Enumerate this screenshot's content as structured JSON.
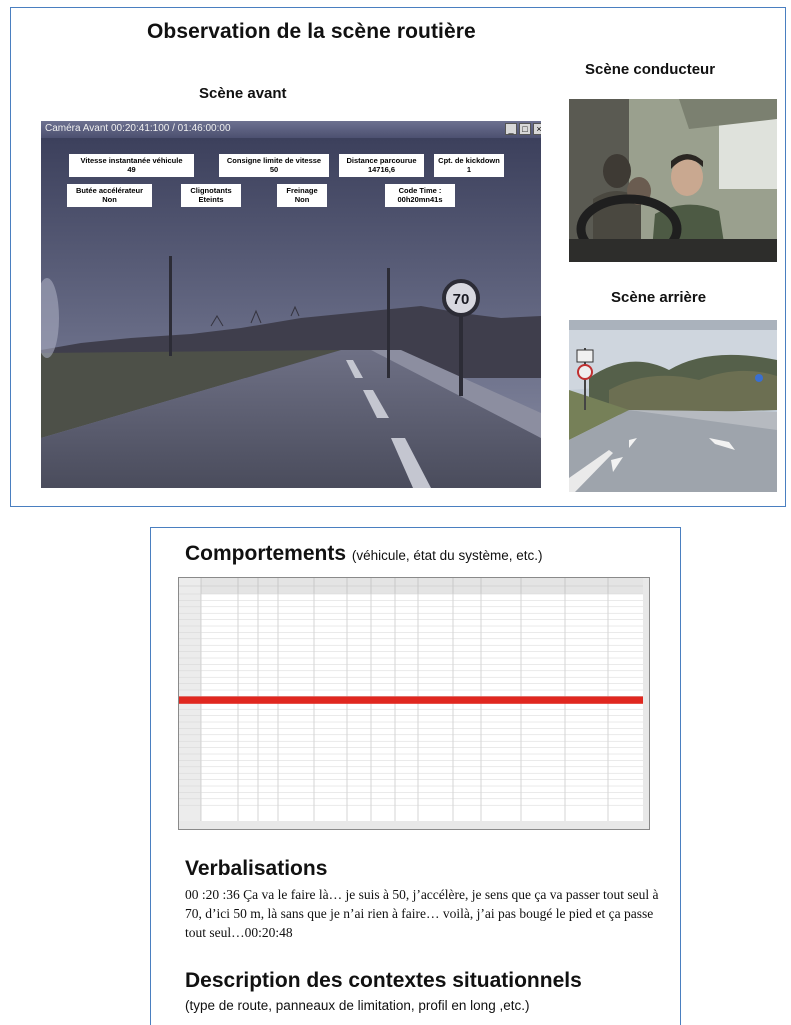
{
  "top_figure": {
    "title": "Observation de la scène routière",
    "front_view": {
      "title": "Scène avant",
      "window_title": "Caméra Avant 00:20:41:100 / 01:46:00:00",
      "window_buttons": [
        "_",
        "□",
        "×"
      ],
      "overlays": [
        {
          "label": "Vitesse instantanée véhicule",
          "value": "49"
        },
        {
          "label": "Consigne limite de vitesse",
          "value": "50"
        },
        {
          "label": "Distance parcourue",
          "value": "14716,6"
        },
        {
          "label": "Cpt. de kickdown",
          "value": "1"
        },
        {
          "label": "Butée accélérateur",
          "value": "Non"
        },
        {
          "label": "Clignotants",
          "value": "Eteints"
        },
        {
          "label": "Freinage",
          "value": "Non"
        },
        {
          "label": "Code Time :",
          "value": "00h20mn41s"
        }
      ],
      "road_sign": "70"
    },
    "driver_view": {
      "title": "Scène conducteur"
    },
    "rear_view": {
      "title": "Scène arrière"
    }
  },
  "document": {
    "behaviours": {
      "title": "Comportements",
      "note": "(véhicule, état du système, etc.)"
    },
    "verbalisations": {
      "title": "Verbalisations",
      "text": "00 :20 :36 Ça va le faire là… je suis à 50, j’accélère, je sens que ça va passer tout seul à 70, d’ici 50 m, là sans que je n’ai rien à faire… voilà, j’ai pas bougé le pied et ça passe tout seul…00:20:48"
    },
    "contexts": {
      "title": "Description des contextes situationnels",
      "note": "(type de route, panneaux de limitation, profil en  long ,etc.)"
    }
  },
  "colors": {
    "frame_border": "#4a7fc0",
    "highlight_row": "#e0271f"
  }
}
